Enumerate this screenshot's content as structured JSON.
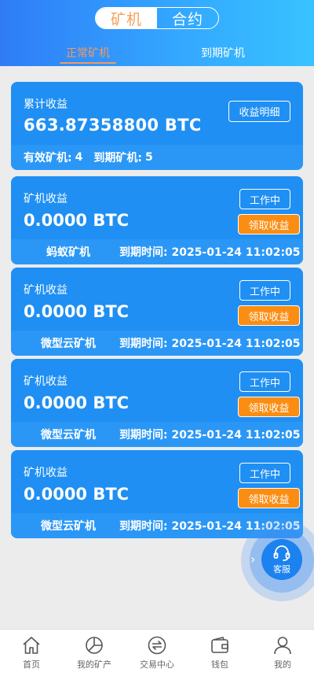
{
  "header": {
    "segments": [
      "矿机",
      "合约"
    ],
    "subtabs": [
      "正常矿机",
      "到期矿机"
    ]
  },
  "summary": {
    "label": "累计收益",
    "total": "663.87358800 BTC",
    "detail_button": "收益明细",
    "effective_label": "有效矿机:",
    "effective_count": "4",
    "expired_label": "到期矿机:",
    "expired_count": "5"
  },
  "miners": [
    {
      "label": "矿机收益",
      "amount": "0.0000 BTC",
      "status": "工作中",
      "claim": "领取收益",
      "name": "蚂蚁矿机",
      "expire": "到期时间: 2025-01-24 11:02:05"
    },
    {
      "label": "矿机收益",
      "amount": "0.0000 BTC",
      "status": "工作中",
      "claim": "领取收益",
      "name": "微型云矿机",
      "expire": "到期时间: 2025-01-24 11:02:05"
    },
    {
      "label": "矿机收益",
      "amount": "0.0000 BTC",
      "status": "工作中",
      "claim": "领取收益",
      "name": "微型云矿机",
      "expire": "到期时间: 2025-01-24 11:02:05"
    },
    {
      "label": "矿机收益",
      "amount": "0.0000 BTC",
      "status": "工作中",
      "claim": "领取收益",
      "name": "微型云矿机",
      "expire": "到期时间: 2025-01-24 11:02:05"
    }
  ],
  "customer_service": {
    "label": "客服",
    "icon": "headset-icon"
  },
  "nav": [
    {
      "label": "首页",
      "icon": "home-icon"
    },
    {
      "label": "我的矿产",
      "icon": "pie-chart-icon"
    },
    {
      "label": "交易中心",
      "icon": "exchange-icon"
    },
    {
      "label": "钱包",
      "icon": "wallet-icon"
    },
    {
      "label": "我的",
      "icon": "user-icon"
    }
  ],
  "colors": {
    "header_gradient": [
      "#2f7cf6",
      "#38c3ff"
    ],
    "card": "#1f8ff3",
    "strip": "#2a97f6",
    "accent_orange": "#f79a5a",
    "claim_button": "#fb8d12"
  }
}
